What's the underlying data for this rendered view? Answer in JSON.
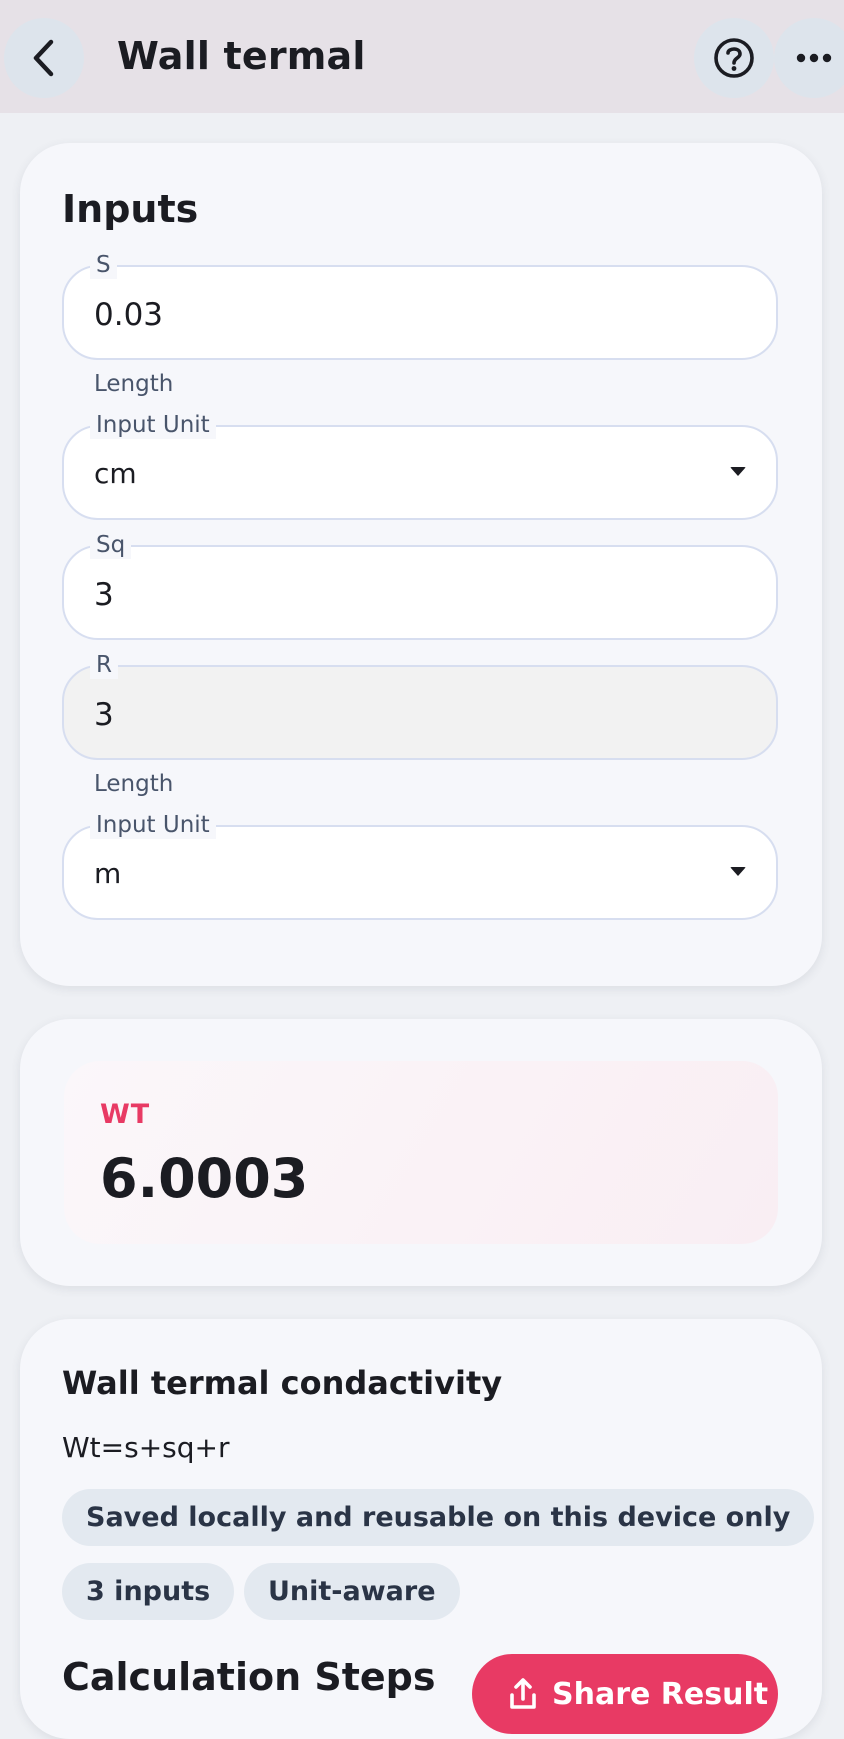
{
  "appbar": {
    "title": "Wall termal",
    "back_icon": "chevron-left-icon",
    "help_icon": "help-circle-icon",
    "more_icon": "more-horizontal-icon"
  },
  "inputs": {
    "title": "Inputs",
    "fields": {
      "s": {
        "label": "S",
        "value": "0.03"
      },
      "s_unit_helper": "Length",
      "s_unit": {
        "label": "Input Unit",
        "value": "cm"
      },
      "sq": {
        "label": "Sq",
        "value": "3"
      },
      "r": {
        "label": "R",
        "value": "3"
      },
      "r_unit_helper": "Length",
      "r_unit": {
        "label": "Input Unit",
        "value": "m"
      }
    }
  },
  "result": {
    "label": "WT",
    "value": "6.0003"
  },
  "formula": {
    "title": "Wall termal condactivity",
    "expression": "Wt=s+sq+r",
    "chips": {
      "saved": "Saved locally and reusable on this device only",
      "inputs": "3 inputs",
      "unit": "Unit-aware"
    },
    "steps_title": "Calculation Steps",
    "share_label": "Share Result",
    "share_icon": "share-icon"
  },
  "colors": {
    "accent": "#e83a64",
    "appbar": "#e6e1e7",
    "background": "#eef0f4"
  }
}
